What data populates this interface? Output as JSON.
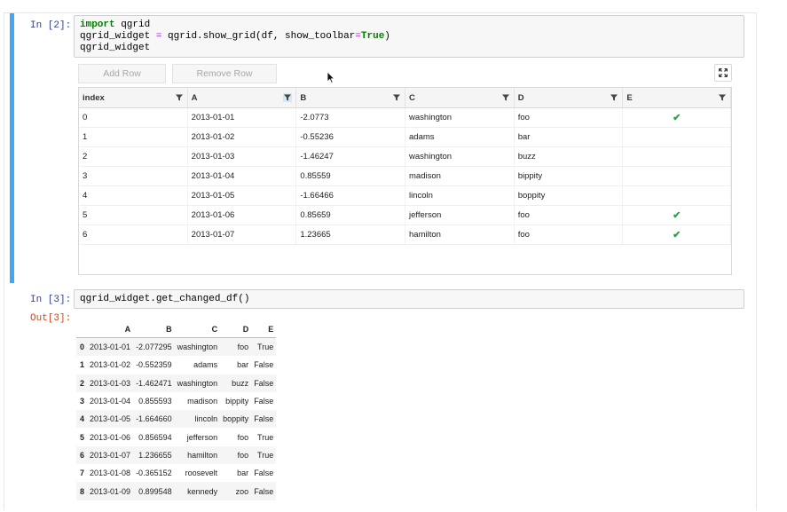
{
  "cell1": {
    "prompt": "In [2]:",
    "code": {
      "line1_kw": "import",
      "line1_rest": " qgrid",
      "line2_a": "qgrid_widget ",
      "line2_eq": "=",
      "line2_b": " qgrid.show_grid(df, show_toolbar",
      "line2_eq2": "=",
      "line2_true": "True",
      "line2_c": ")",
      "line3": "qgrid_widget"
    }
  },
  "toolbar": {
    "add_row_label": "Add Row",
    "remove_row_label": "Remove Row",
    "expand_icon": "expand-icon"
  },
  "grid": {
    "columns": [
      {
        "label": "index",
        "filter_active": false
      },
      {
        "label": "A",
        "filter_active": true
      },
      {
        "label": "B",
        "filter_active": false
      },
      {
        "label": "C",
        "filter_active": false
      },
      {
        "label": "D",
        "filter_active": false
      },
      {
        "label": "E",
        "filter_active": false
      }
    ],
    "rows": [
      {
        "index": "0",
        "A": "2013-01-01",
        "B": "-2.0773",
        "C": "washington",
        "D": "foo",
        "E": true
      },
      {
        "index": "1",
        "A": "2013-01-02",
        "B": "-0.55236",
        "C": "adams",
        "D": "bar",
        "E": false
      },
      {
        "index": "2",
        "A": "2013-01-03",
        "B": "-1.46247",
        "C": "washington",
        "D": "buzz",
        "E": false
      },
      {
        "index": "3",
        "A": "2013-01-04",
        "B": "0.85559",
        "C": "madison",
        "D": "bippity",
        "E": false
      },
      {
        "index": "4",
        "A": "2013-01-05",
        "B": "-1.66466",
        "C": "lincoln",
        "D": "boppity",
        "E": false
      },
      {
        "index": "5",
        "A": "2013-01-06",
        "B": "0.85659",
        "C": "jefferson",
        "D": "foo",
        "E": true
      },
      {
        "index": "6",
        "A": "2013-01-07",
        "B": "1.23665",
        "C": "hamilton",
        "D": "foo",
        "E": true
      }
    ],
    "check_glyph": "✔",
    "check_color": "#2ea043"
  },
  "cell2": {
    "prompt": "In [3]:",
    "code": "qgrid_widget.get_changed_df()"
  },
  "output": {
    "prompt": "Out[3]:",
    "columns": [
      "",
      "A",
      "B",
      "C",
      "D",
      "E"
    ],
    "rows": [
      [
        "0",
        "2013-01-01",
        "-2.077295",
        "washington",
        "foo",
        "True"
      ],
      [
        "1",
        "2013-01-02",
        "-0.552359",
        "adams",
        "bar",
        "False"
      ],
      [
        "2",
        "2013-01-03",
        "-1.462471",
        "washington",
        "buzz",
        "False"
      ],
      [
        "3",
        "2013-01-04",
        "0.855593",
        "madison",
        "bippity",
        "False"
      ],
      [
        "4",
        "2013-01-05",
        "-1.664660",
        "lincoln",
        "boppity",
        "False"
      ],
      [
        "5",
        "2013-01-06",
        "0.856594",
        "jefferson",
        "foo",
        "True"
      ],
      [
        "6",
        "2013-01-07",
        "1.236655",
        "hamilton",
        "foo",
        "True"
      ],
      [
        "7",
        "2013-01-08",
        "-0.365152",
        "roosevelt",
        "bar",
        "False"
      ],
      [
        "8",
        "2013-01-09",
        "0.899548",
        "kennedy",
        "zoo",
        "False"
      ]
    ]
  },
  "colors": {
    "active_cell_bar": "#42a5f5",
    "in_prompt": "#303f9f",
    "out_prompt": "#d84315",
    "keyword": "#008000"
  }
}
